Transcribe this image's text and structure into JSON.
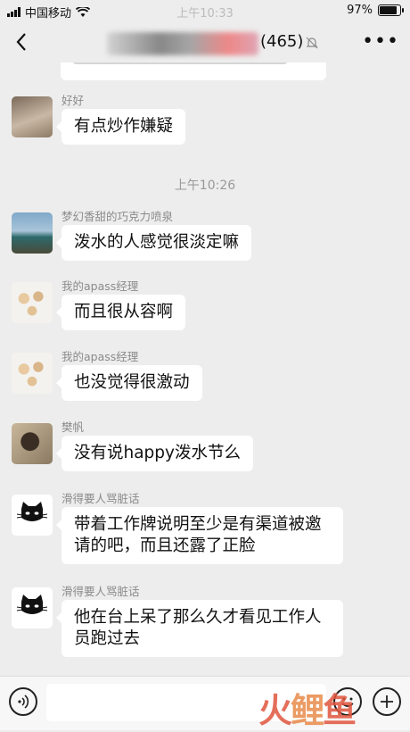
{
  "status_bar": {
    "carrier": "中国移动",
    "time": "上午10:33",
    "battery": "97%",
    "battery_level": 0.97
  },
  "nav": {
    "member_count": "(465)"
  },
  "messages": [
    {
      "type": "msg",
      "sender": "好好",
      "text": "有点炒作嫌疑"
    },
    {
      "type": "time",
      "text": "上午10:26"
    },
    {
      "type": "msg",
      "sender": "梦幻香甜的巧克力喷泉",
      "text": "泼水的人感觉很淡定嘛"
    },
    {
      "type": "msg",
      "sender": "我的apass经理",
      "text": "而且很从容啊"
    },
    {
      "type": "msg",
      "sender": "我的apass经理",
      "text": "也没觉得很激动"
    },
    {
      "type": "msg",
      "sender": "樊帆",
      "text": "没有说happy泼水节么"
    },
    {
      "type": "msg",
      "sender": "滑得要人骂脏话",
      "text": "带着工作牌说明至少是有渠道被邀请的吧，而且还露了正脸"
    },
    {
      "type": "msg",
      "sender": "滑得要人骂脏话",
      "text": "他在台上呆了那么久才看见工作人员跑过去"
    }
  ],
  "watermark": {
    "text_a": "火",
    "text_b": "鲤",
    "text_c": "鱼"
  },
  "colors": {
    "background": "#ededed",
    "bubble": "#ffffff",
    "watermark": "#e0563e"
  }
}
